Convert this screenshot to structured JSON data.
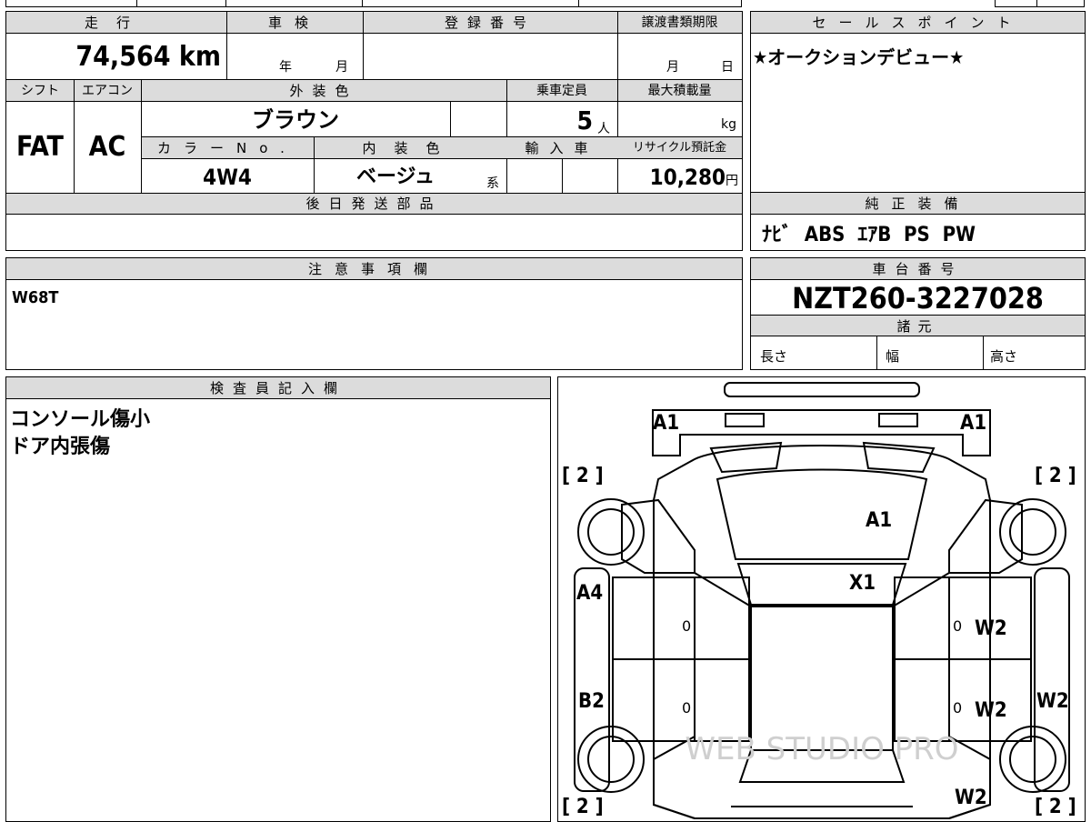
{
  "top_table": {
    "mileage_header": "走行",
    "inspection_header": "車検",
    "registration_header": "登録番号",
    "transfer_deadline_header": "譲渡書類期限",
    "mileage_value": "74,564",
    "mileage_unit": "km",
    "inspection_year_unit": "年",
    "inspection_month_unit": "月",
    "deadline_month_unit": "月",
    "deadline_day_unit": "日",
    "shift_header": "シフト",
    "ac_header": "エアコン",
    "exterior_color_header": "外装色",
    "capacity_header": "乗車定員",
    "max_load_header": "最大積載量",
    "shift_value": "FAT",
    "ac_value": "AC",
    "exterior_color_value": "ブラウン",
    "capacity_value": "5",
    "capacity_unit": "人",
    "max_load_unit": "kg",
    "color_no_header": "カラーNo.",
    "interior_color_header": "内装色",
    "import_header": "輸入車",
    "recycle_header": "リサイクル預託金",
    "color_no_value": "4W4",
    "interior_color_value": "ベージュ",
    "interior_color_suffix": "系",
    "recycle_value": "10,280",
    "recycle_unit": "円",
    "later_parts_header": "後日発送部品"
  },
  "sales_point": {
    "header": "セールスポイント",
    "text": "★オークションデビュー★"
  },
  "standard_equipment": {
    "header": "純正装備",
    "text": "ﾅﾋﾞ  ABS  ｴｱB  PS  PW"
  },
  "notes": {
    "header": "注意事項欄",
    "text": "W68T"
  },
  "chassis": {
    "header": "車台番号",
    "value": "NZT260-3227028",
    "specs_header": "諸元",
    "length_label": "長さ",
    "width_label": "幅",
    "height_label": "高さ"
  },
  "inspector": {
    "header": "検査員記入欄",
    "line1": "コンソール傷小",
    "line2": "ドア内張傷"
  },
  "diagram": {
    "marks": {
      "front_left": "A1",
      "front_right": "A1",
      "hood": "A1",
      "windshield": "X1",
      "left_front_side": "A4",
      "left_rear_side": "B2",
      "right_front_door": "W2",
      "right_rear_door": "W2",
      "right_rear_side": "W2",
      "rear_right": "W2",
      "bracket_tl": "[ 2 ]",
      "bracket_tr": "[ 2 ]",
      "bracket_bl": "[ 2 ]",
      "bracket_br": "[ 2 ]",
      "zero_lf": "0",
      "zero_lr": "0",
      "zero_rf": "0",
      "zero_rr": "0"
    },
    "watermark": "WEB STUDIO PRO"
  }
}
